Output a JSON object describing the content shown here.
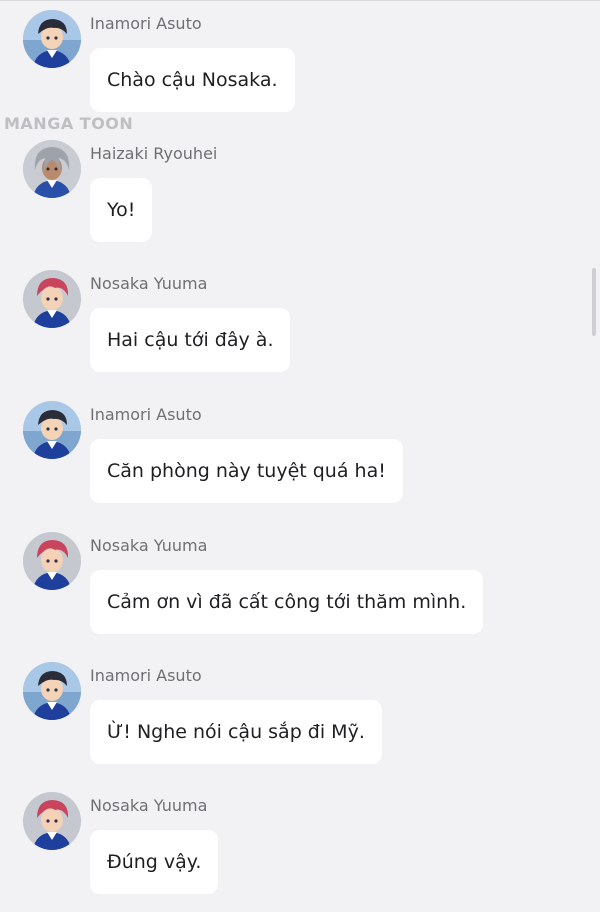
{
  "watermark": "MANGA TOON",
  "messages": [
    {
      "sender": "Inamori Asuto",
      "text": "Chào cậu Nosaka.",
      "avatar": "asuto-avatar"
    },
    {
      "sender": "Haizaki Ryouhei",
      "text": "Yo!",
      "avatar": "haizaki-avatar"
    },
    {
      "sender": "Nosaka Yuuma",
      "text": "Hai cậu tới đây à.",
      "avatar": "nosaka-avatar"
    },
    {
      "sender": "Inamori Asuto",
      "text": "Căn phòng này tuyệt quá ha!",
      "avatar": "asuto-avatar"
    },
    {
      "sender": "Nosaka Yuuma",
      "text": "Cảm ơn vì đã cất công tới thăm mình.",
      "avatar": "nosaka-avatar"
    },
    {
      "sender": "Inamori Asuto",
      "text": "Ừ! Nghe nói cậu sắp đi Mỹ.",
      "avatar": "asuto-avatar"
    },
    {
      "sender": "Nosaka Yuuma",
      "text": "Đúng vậy.",
      "avatar": "nosaka-avatar"
    }
  ],
  "colors": {
    "background": "#f2f2f4",
    "bubble": "#ffffff",
    "name_text": "#6f6f74",
    "message_text": "#1f1f22"
  }
}
